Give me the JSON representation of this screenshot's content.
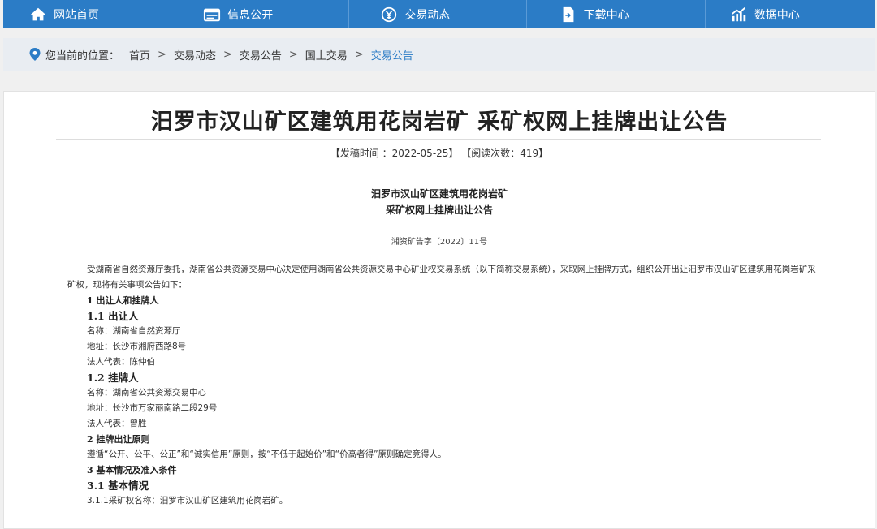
{
  "nav": {
    "items": [
      {
        "label": "网站首页",
        "icon": "home-icon"
      },
      {
        "label": "信息公开",
        "icon": "list-icon"
      },
      {
        "label": "交易动态",
        "icon": "yen-icon"
      },
      {
        "label": "下载中心",
        "icon": "download-icon"
      },
      {
        "label": "数据中心",
        "icon": "chart-icon"
      }
    ]
  },
  "breadcrumb": {
    "label": "您当前的位置：",
    "items": [
      "首页",
      "交易动态",
      "交易公告",
      "国土交易",
      "交易公告"
    ],
    "separator": ">"
  },
  "article": {
    "title": "汨罗市汉山矿区建筑用花岗岩矿 采矿权网上挂牌出让公告",
    "meta": "【发稿时间 ：2022-05-25】 【阅读次数：419】",
    "subtitle_line1": "汨罗市汉山矿区建筑用花岗岩矿",
    "subtitle_line2": "采矿权网上挂牌出让公告",
    "doc_no": "湘资矿告字〔2022〕11号",
    "paragraphs": [
      "受湖南省自然资源厅委托，湖南省公共资源交易中心决定使用湖南省公共资源交易中心矿业权交易系统（以下简称交易系统），采取网上挂牌方式，组织公开出让汨罗市汉山矿区建筑用花岗岩矿采矿权，现将有关事项公告如下：",
      "1 出让人和挂牌人",
      "1.1 出让人",
      "名称：湖南省自然资源厅",
      "地址：长沙市湘府西路8号",
      "法人代表：陈仲伯",
      "1.2 挂牌人",
      "名称：湖南省公共资源交易中心",
      "地址：长沙市万家丽南路二段29号",
      "法人代表：曾胜",
      "2 挂牌出让原则",
      "遵循“公开、公平、公正”和“诚实信用”原则，按“不低于起始价”和“价高者得”原则确定竞得人。",
      "3 基本情况及准入条件",
      "3.1 基本情况",
      "3.1.1采矿权名称：汨罗市汉山矿区建筑用花岗岩矿。"
    ]
  },
  "colors": {
    "nav_bg": "#2b7cc6",
    "accent": "#2b7cc6",
    "crumb_bg": "#e9edf2"
  }
}
